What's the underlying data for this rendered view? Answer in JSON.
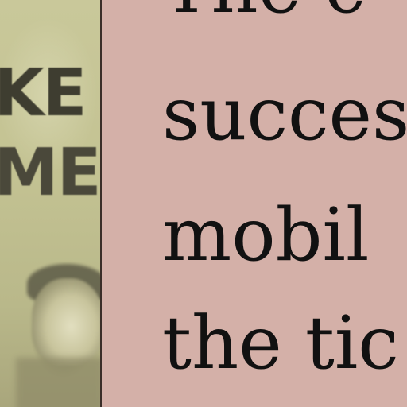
{
  "photo": {
    "poster_line_1": "KE",
    "poster_line_2": "ME"
  },
  "text": {
    "lines": [
      "The c",
      "succes",
      "mobil",
      "the tic"
    ]
  },
  "colors": {
    "background": "#d4b0a8",
    "text": "#111111",
    "photo_tint": "#c9c89a"
  }
}
